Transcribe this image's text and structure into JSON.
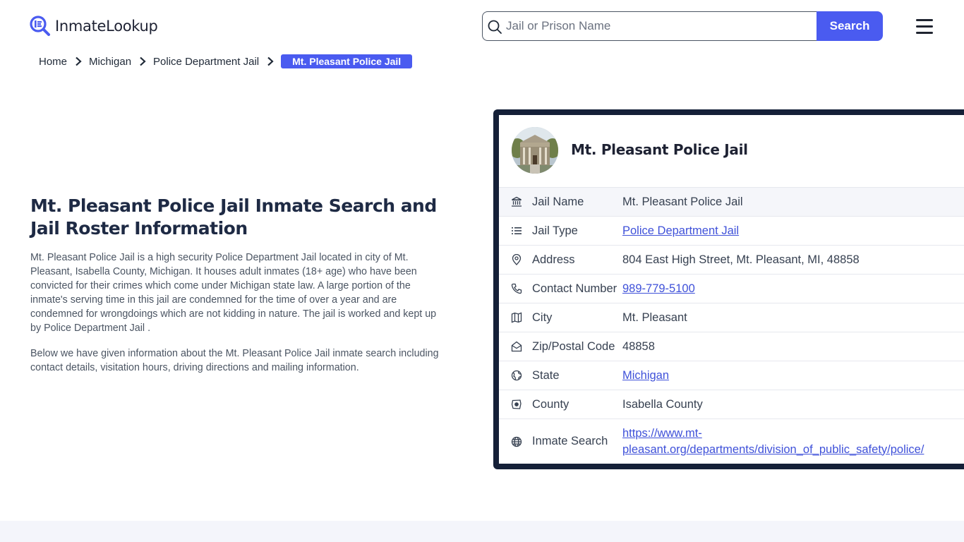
{
  "header": {
    "logo_text": "InmateLookup",
    "search_placeholder": "Jail or Prison Name",
    "search_button": "Search",
    "menu_icon": "hamburger-icon"
  },
  "breadcrumb": {
    "items": [
      "Home",
      "Michigan",
      "Police Department Jail"
    ],
    "current": "Mt. Pleasant Police Jail"
  },
  "intro": {
    "heading": "Mt. Pleasant Police Jail Inmate Search and Jail Roster Information",
    "paragraph1": "Mt. Pleasant Police Jail is a high security Police Department Jail located in city of Mt. Pleasant, Isabella County, Michigan. It houses adult inmates (18+ age) who have been convicted for their crimes which come under Michigan state law. A large portion of the inmate's serving time in this jail are condemned for the time of over a year and are condemned for wrongdoings which are not kidding in nature. The jail is worked and kept up by Police Department Jail .",
    "paragraph2": "Below we have given information about the Mt. Pleasant Police Jail inmate search including contact details, visitation hours, driving directions and mailing information."
  },
  "card": {
    "title": "Mt. Pleasant Police Jail",
    "rows": [
      {
        "icon": "bank-icon",
        "label": "Jail Name",
        "value": "Mt. Pleasant Police Jail"
      },
      {
        "icon": "list-icon",
        "label": "Jail Type",
        "value": "Police Department Jail"
      },
      {
        "icon": "map-pin-icon",
        "label": "Address",
        "value": "804 East High Street, Mt. Pleasant, MI, 48858"
      },
      {
        "icon": "phone-icon",
        "label": "Contact Number",
        "value": "989-779-5100"
      },
      {
        "icon": "map-icon",
        "label": "City",
        "value": "Mt. Pleasant"
      },
      {
        "icon": "mail-open-icon",
        "label": "Zip/Postal Code",
        "value": "48858"
      },
      {
        "icon": "globe-pin-icon",
        "label": "State",
        "value": "Michigan"
      },
      {
        "icon": "county-icon",
        "label": "County",
        "value": "Isabella County"
      },
      {
        "icon": "globe-icon",
        "label": "Inmate Search",
        "value": "https://www.mt-pleasant.org/departments/division_of_public_safety/police/",
        "value_line1": "https://www.mt-",
        "value_line2": "pleasant.org/departments/division_of_public_safety/police/"
      }
    ]
  },
  "colors": {
    "accent": "#4a5bf0",
    "card_border": "#152038",
    "link": "#3f51d9",
    "heading": "#1e2a44"
  }
}
